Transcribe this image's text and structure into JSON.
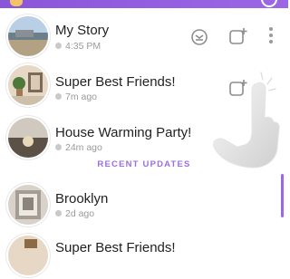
{
  "stories": [
    {
      "name": "My Story",
      "meta": "4:35 PM"
    },
    {
      "name": "Super Best Friends!",
      "meta": "7m ago"
    },
    {
      "name": "House Warming Party!",
      "meta": "24m ago"
    }
  ],
  "section_header": "RECENT UPDATES",
  "recent": [
    {
      "name": "Brooklyn",
      "meta": "2d ago"
    },
    {
      "name": "Super Best Friends!",
      "meta": ""
    }
  ],
  "icons": {
    "top_left": "ghost-badge-icon",
    "top_right": "settings-circle-icon",
    "story_settings": "gear-circle-icon",
    "add_snap": "add-snap-icon",
    "more": "more-vertical-icon",
    "pointer": "pointing-hand-icon"
  },
  "colors": {
    "accent": "#9b67e6",
    "text": "#222222",
    "muted": "#9a9a9a"
  }
}
